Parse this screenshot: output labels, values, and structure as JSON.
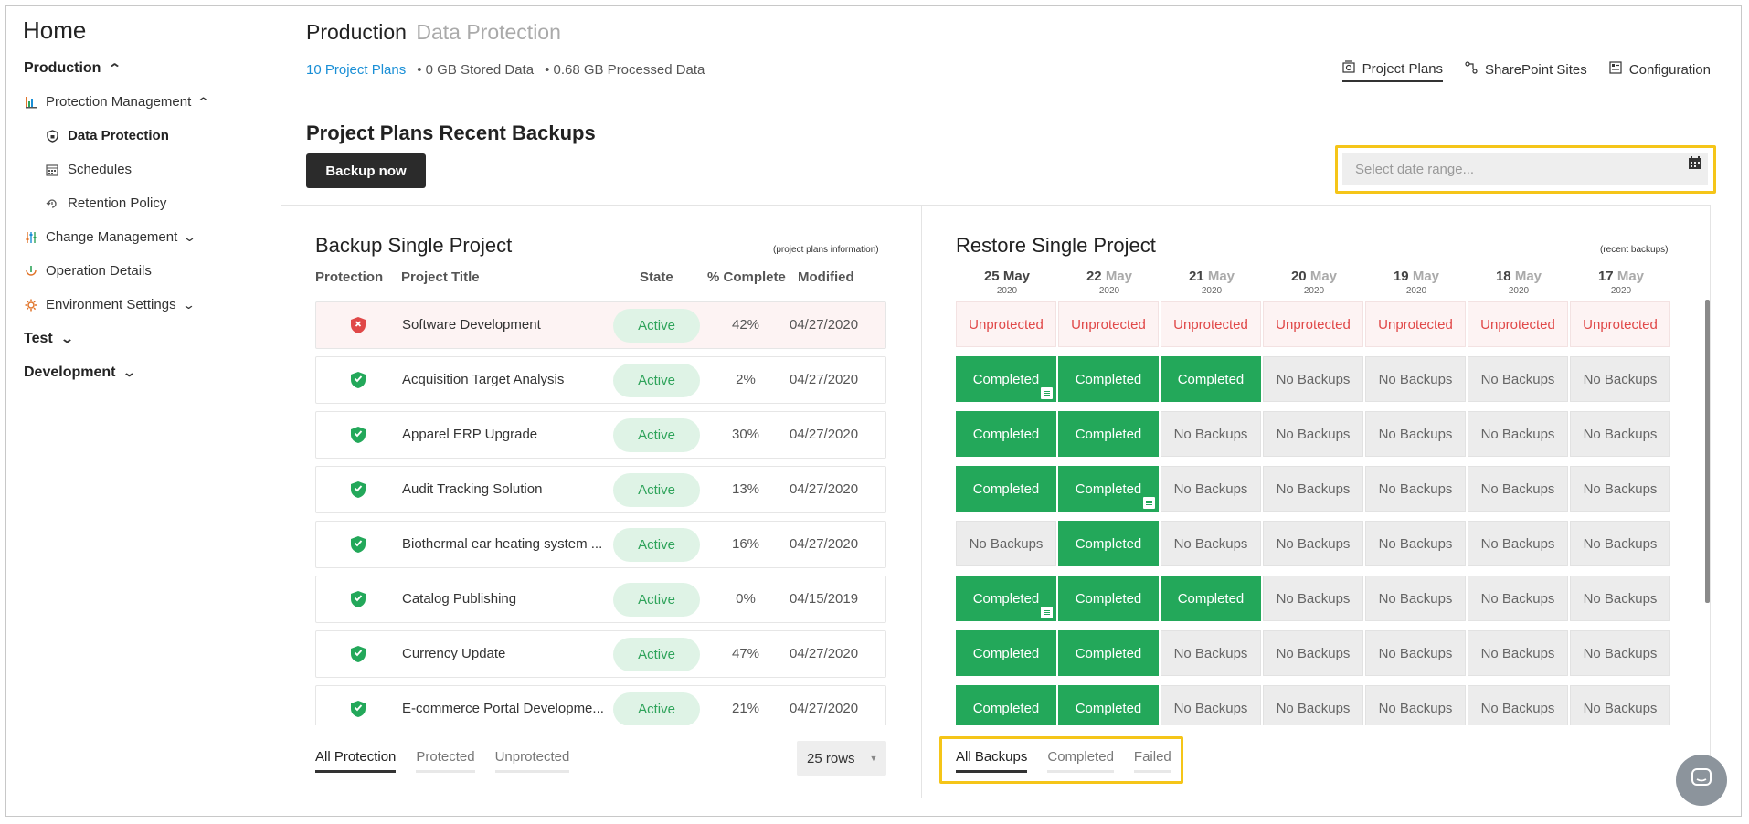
{
  "sidebar": {
    "home": "Home",
    "production": "Production",
    "protection_management": "Protection Management",
    "data_protection": "Data Protection",
    "schedules": "Schedules",
    "retention_policy": "Retention Policy",
    "change_management": "Change Management",
    "operation_details": "Operation Details",
    "environment_settings": "Environment Settings",
    "test": "Test",
    "development": "Development"
  },
  "header": {
    "title": "Production",
    "subtitle": "Data Protection",
    "project_plans_link": "10 Project Plans",
    "stored": "• 0 GB Stored Data",
    "processed": "• 0.68 GB Processed Data"
  },
  "topnav": {
    "project_plans": "Project Plans",
    "sharepoint_sites": "SharePoint Sites",
    "configuration": "Configuration"
  },
  "section": {
    "title": "Project Plans Recent Backups",
    "backup_now": "Backup now",
    "date_placeholder": "Select date range..."
  },
  "backup_panel": {
    "title": "Backup Single Project",
    "note": "(project plans information)",
    "columns": {
      "protection": "Protection",
      "project_title": "Project Title",
      "state": "State",
      "complete": "% Complete",
      "modified": "Modified"
    },
    "rows": [
      {
        "title": "Software Development",
        "state": "Active",
        "pct": "42%",
        "modified": "04/27/2020"
      },
      {
        "title": "Acquisition Target Analysis",
        "state": "Active",
        "pct": "2%",
        "modified": "04/27/2020"
      },
      {
        "title": "Apparel ERP Upgrade",
        "state": "Active",
        "pct": "30%",
        "modified": "04/27/2020"
      },
      {
        "title": "Audit Tracking Solution",
        "state": "Active",
        "pct": "13%",
        "modified": "04/27/2020"
      },
      {
        "title": "Biothermal ear heating system ...",
        "state": "Active",
        "pct": "16%",
        "modified": "04/27/2020"
      },
      {
        "title": "Catalog Publishing",
        "state": "Active",
        "pct": "0%",
        "modified": "04/15/2019"
      },
      {
        "title": "Currency Update",
        "state": "Active",
        "pct": "47%",
        "modified": "04/27/2020"
      },
      {
        "title": "E-commerce Portal Developme...",
        "state": "Active",
        "pct": "21%",
        "modified": "04/27/2020"
      }
    ],
    "tabs": {
      "all": "All Protection",
      "protected": "Protected",
      "unprotected": "Unprotected"
    },
    "rows_select": "25 rows"
  },
  "restore_panel": {
    "title": "Restore Single Project",
    "note": "(recent backups)",
    "dates": [
      {
        "day": "25",
        "month": "May",
        "year": "2020"
      },
      {
        "day": "22",
        "month": "May",
        "year": "2020"
      },
      {
        "day": "21",
        "month": "May",
        "year": "2020"
      },
      {
        "day": "20",
        "month": "May",
        "year": "2020"
      },
      {
        "day": "19",
        "month": "May",
        "year": "2020"
      },
      {
        "day": "18",
        "month": "May",
        "year": "2020"
      },
      {
        "day": "17",
        "month": "May",
        "year": "2020"
      }
    ],
    "labels": {
      "unprotected": "Unprotected",
      "completed": "Completed",
      "no_backups": "No Backups"
    },
    "tabs": {
      "all": "All Backups",
      "completed": "Completed",
      "failed": "Failed"
    }
  },
  "colors": {
    "accent_link": "#1a8fd6",
    "completed": "#23a85a",
    "unprotected": "#e04848",
    "highlight": "#f5c518"
  }
}
